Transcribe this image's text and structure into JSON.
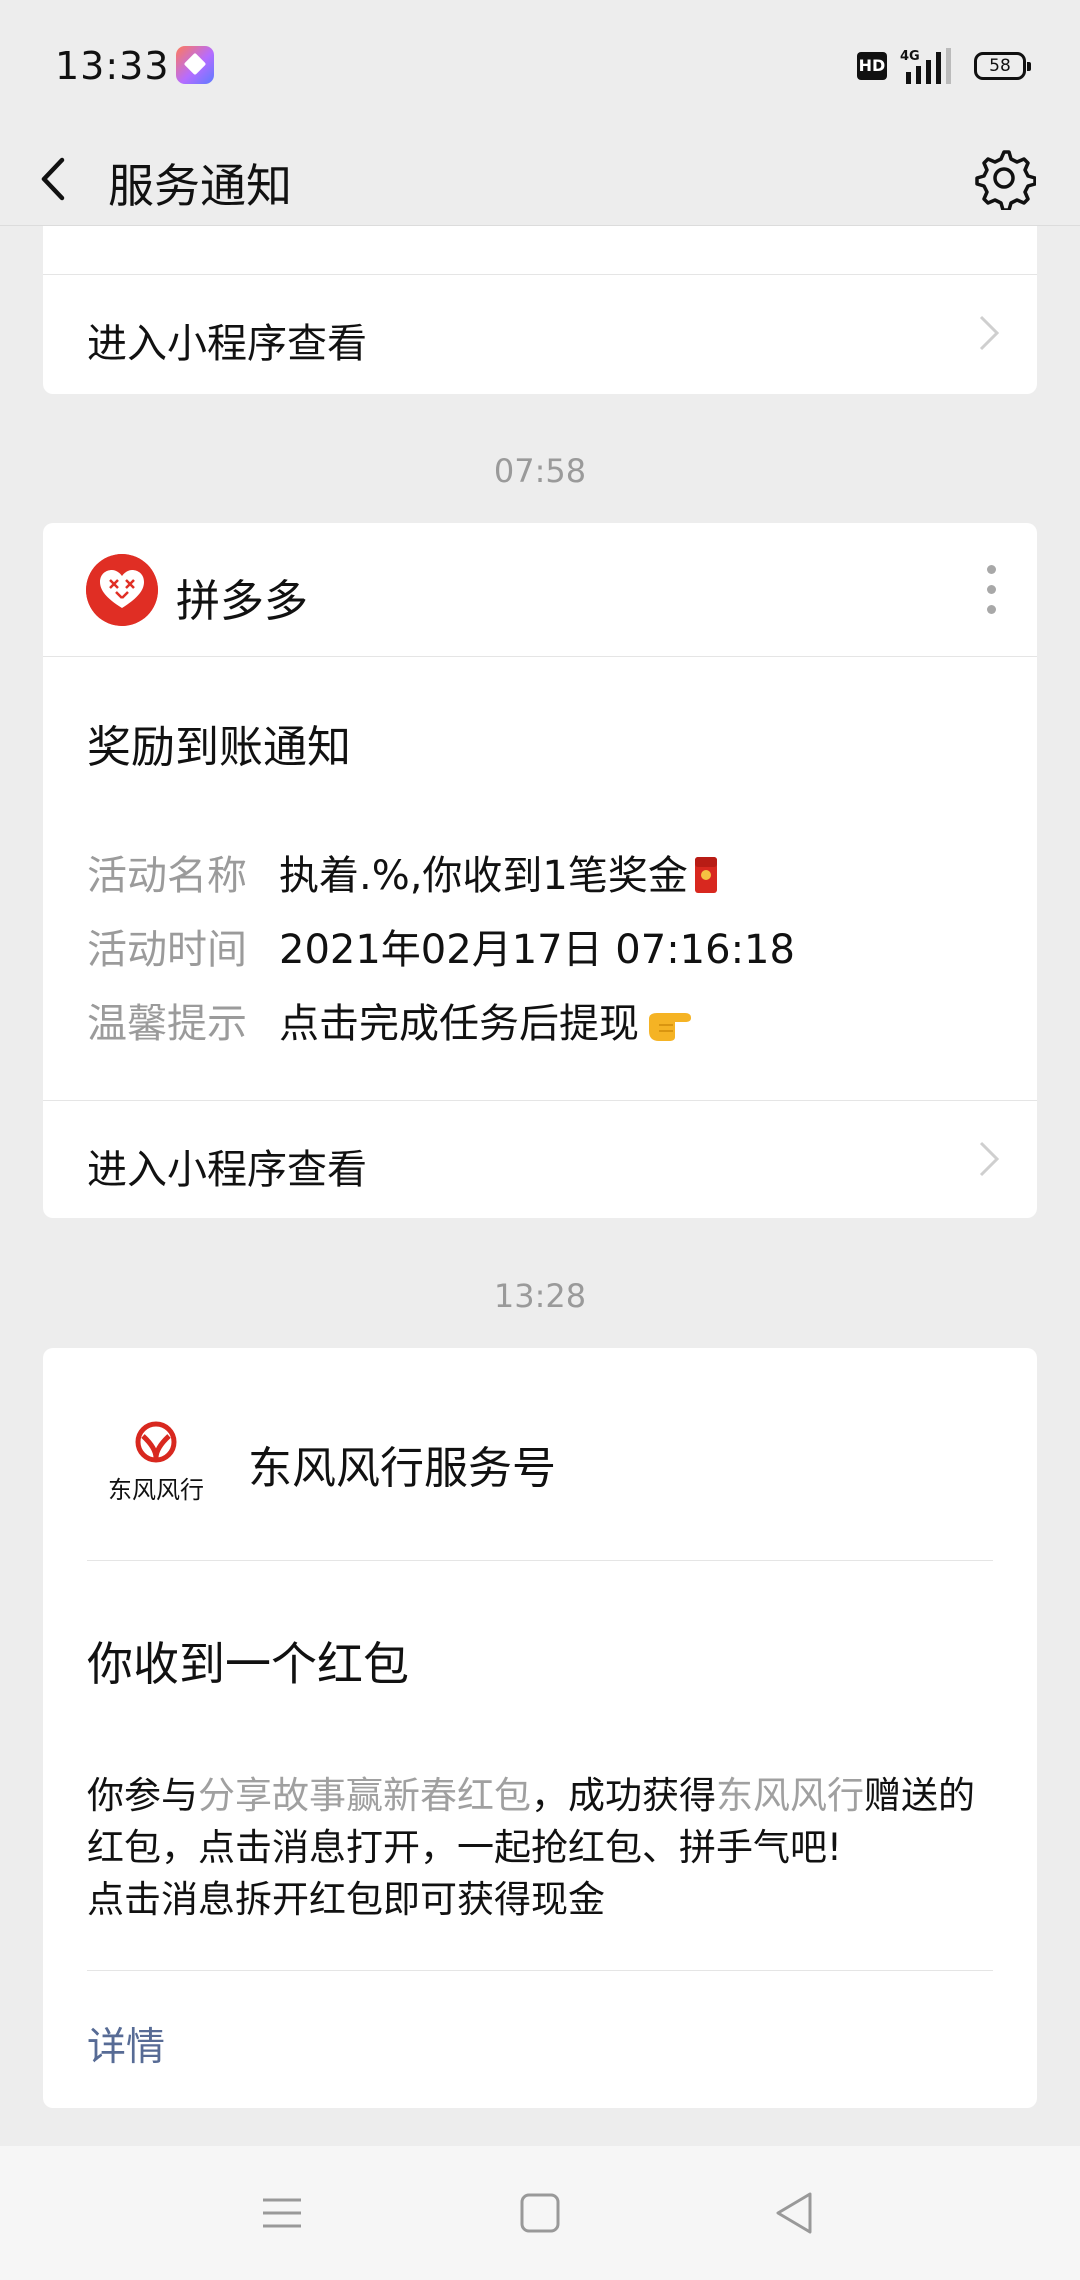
{
  "status_bar": {
    "time": "13:33",
    "hd_label": "HD",
    "network": "4G",
    "battery": "58"
  },
  "nav": {
    "title": "服务通知",
    "back_icon": "chevron-left-icon",
    "settings_icon": "gear-icon"
  },
  "card1": {
    "link_label": "进入小程序查看"
  },
  "separators": {
    "first": "07:58",
    "second": "13:28"
  },
  "card2": {
    "source_name": "拼多多",
    "title": "奖励到账通知",
    "rows": [
      {
        "key": "活动名称",
        "value": "执着.%,你收到1笔奖金"
      },
      {
        "key": "活动时间",
        "value": "2021年02月17日 07:16:18"
      },
      {
        "key": "温馨提示",
        "value": "点击完成任务后提现"
      }
    ],
    "link_label": "进入小程序查看"
  },
  "card3": {
    "logo_text": "东风风行",
    "source_name": "东风风行服务号",
    "title": "你收到一个红包",
    "body": {
      "p1": "你参与",
      "h1": "分享故事赢新春红包",
      "p2": "，成功获得",
      "h2": "东风风行",
      "p3": "赠送的红包，点击消息打开，一起抢红包、拼手气吧!",
      "line2": "点击消息拆开红包即可获得现金"
    },
    "detail_label": "详情"
  },
  "colors": {
    "background": "#ededed",
    "card": "#ffffff",
    "link_blue": "#576b95",
    "pdd_red": "#e02e24"
  }
}
